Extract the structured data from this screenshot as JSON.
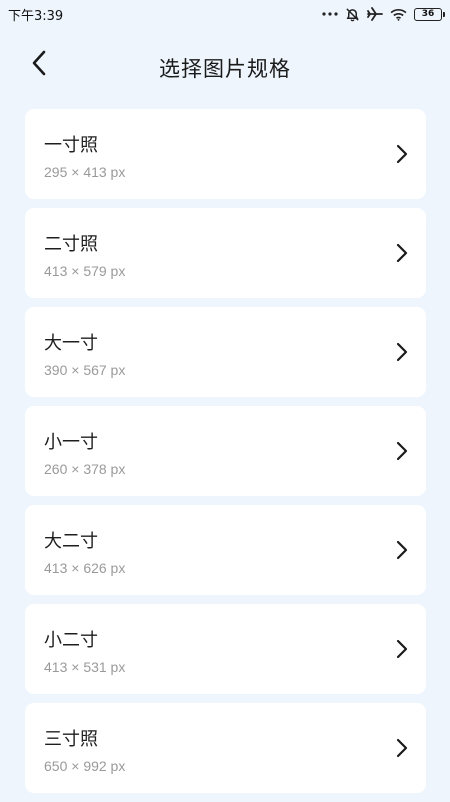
{
  "status_bar": {
    "time": "下午3:39",
    "battery": "36",
    "icons": [
      "more-dots-icon",
      "alarm-off-icon",
      "airplane-icon",
      "wifi-icon",
      "battery-icon"
    ]
  },
  "header": {
    "title": "选择图片规格",
    "back_icon": "chevron-left-icon"
  },
  "items": [
    {
      "title": "一寸照",
      "size": "295 × 413 px"
    },
    {
      "title": "二寸照",
      "size": "413 × 579 px"
    },
    {
      "title": "大一寸",
      "size": "390 × 567 px"
    },
    {
      "title": "小一寸",
      "size": "260 × 378 px"
    },
    {
      "title": "大二寸",
      "size": "413 × 626 px"
    },
    {
      "title": "小二寸",
      "size": "413 × 531 px"
    },
    {
      "title": "三寸照",
      "size": "650 × 992 px"
    }
  ],
  "colors": {
    "background": "#eef5fd",
    "card": "#ffffff",
    "subtext": "#9a9a9a"
  }
}
